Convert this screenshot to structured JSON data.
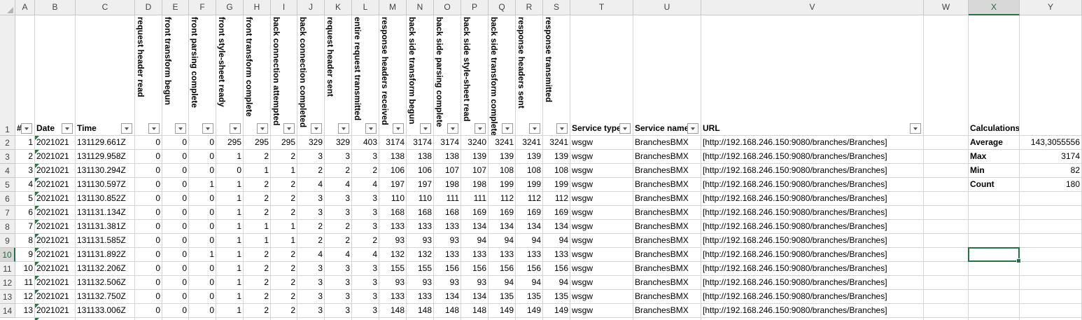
{
  "columns": [
    "A",
    "B",
    "C",
    "D",
    "E",
    "F",
    "G",
    "H",
    "I",
    "J",
    "K",
    "L",
    "M",
    "N",
    "O",
    "P",
    "Q",
    "R",
    "S",
    "T",
    "U",
    "V",
    "W",
    "X",
    "Y"
  ],
  "row_numbers": [
    "1",
    "2",
    "3",
    "4",
    "5",
    "6",
    "7",
    "8",
    "9",
    "10",
    "11",
    "12",
    "13",
    "14"
  ],
  "selected_column": "X",
  "selected_row": "10",
  "headers": {
    "A": "#",
    "B": "Date",
    "C": "Time",
    "D": "request header read",
    "E": "front transform begun",
    "F": "front parsing complete",
    "G": "front style-sheet ready",
    "H": "front transform complete",
    "I": "back connection attempted",
    "J": "back connection completed",
    "K": "request header sent",
    "L": "entire request transmitted",
    "M": "response headers received",
    "N": "back side transform begun",
    "O": "back side parsing complete",
    "P": "back side style-sheet read",
    "Q": "back side transform complete",
    "R": "response headers sent",
    "S": "response transmitted",
    "T": "Service type",
    "U": "Service name",
    "V": "URL",
    "X": "Calculations"
  },
  "rows": [
    [
      "1",
      "2021021",
      "131129.661Z",
      "0",
      "0",
      "0",
      "295",
      "295",
      "295",
      "329",
      "329",
      "403",
      "3174",
      "3174",
      "3174",
      "3240",
      "3241",
      "3241",
      "3241",
      "wsgw",
      "BranchesBMX",
      "[http://192.168.246.150:9080/branches/Branches]"
    ],
    [
      "2",
      "2021021",
      "131129.958Z",
      "0",
      "0",
      "0",
      "1",
      "2",
      "2",
      "3",
      "3",
      "3",
      "138",
      "138",
      "138",
      "139",
      "139",
      "139",
      "139",
      "wsgw",
      "BranchesBMX",
      "[http://192.168.246.150:9080/branches/Branches]"
    ],
    [
      "3",
      "2021021",
      "131130.294Z",
      "0",
      "0",
      "0",
      "0",
      "1",
      "1",
      "2",
      "2",
      "2",
      "106",
      "106",
      "107",
      "107",
      "108",
      "108",
      "108",
      "wsgw",
      "BranchesBMX",
      "[http://192.168.246.150:9080/branches/Branches]"
    ],
    [
      "4",
      "2021021",
      "131130.597Z",
      "0",
      "0",
      "1",
      "1",
      "2",
      "2",
      "4",
      "4",
      "4",
      "197",
      "197",
      "198",
      "198",
      "199",
      "199",
      "199",
      "wsgw",
      "BranchesBMX",
      "[http://192.168.246.150:9080/branches/Branches]"
    ],
    [
      "5",
      "2021021",
      "131130.852Z",
      "0",
      "0",
      "0",
      "1",
      "2",
      "2",
      "3",
      "3",
      "3",
      "110",
      "110",
      "111",
      "111",
      "112",
      "112",
      "112",
      "wsgw",
      "BranchesBMX",
      "[http://192.168.246.150:9080/branches/Branches]"
    ],
    [
      "6",
      "2021021",
      "131131.134Z",
      "0",
      "0",
      "0",
      "1",
      "2",
      "2",
      "3",
      "3",
      "3",
      "168",
      "168",
      "168",
      "169",
      "169",
      "169",
      "169",
      "wsgw",
      "BranchesBMX",
      "[http://192.168.246.150:9080/branches/Branches]"
    ],
    [
      "7",
      "2021021",
      "131131.381Z",
      "0",
      "0",
      "0",
      "1",
      "1",
      "1",
      "2",
      "2",
      "3",
      "133",
      "133",
      "133",
      "134",
      "134",
      "134",
      "134",
      "wsgw",
      "BranchesBMX",
      "[http://192.168.246.150:9080/branches/Branches]"
    ],
    [
      "8",
      "2021021",
      "131131.585Z",
      "0",
      "0",
      "0",
      "1",
      "1",
      "1",
      "2",
      "2",
      "2",
      "93",
      "93",
      "93",
      "94",
      "94",
      "94",
      "94",
      "wsgw",
      "BranchesBMX",
      "[http://192.168.246.150:9080/branches/Branches]"
    ],
    [
      "9",
      "2021021",
      "131131.892Z",
      "0",
      "0",
      "1",
      "1",
      "2",
      "2",
      "4",
      "4",
      "4",
      "132",
      "132",
      "133",
      "133",
      "133",
      "133",
      "133",
      "wsgw",
      "BranchesBMX",
      "[http://192.168.246.150:9080/branches/Branches]"
    ],
    [
      "10",
      "2021021",
      "131132.206Z",
      "0",
      "0",
      "0",
      "1",
      "2",
      "2",
      "3",
      "3",
      "3",
      "155",
      "155",
      "156",
      "156",
      "156",
      "156",
      "156",
      "wsgw",
      "BranchesBMX",
      "[http://192.168.246.150:9080/branches/Branches]"
    ],
    [
      "11",
      "2021021",
      "131132.506Z",
      "0",
      "0",
      "0",
      "1",
      "2",
      "2",
      "3",
      "3",
      "3",
      "93",
      "93",
      "93",
      "93",
      "94",
      "94",
      "94",
      "wsgw",
      "BranchesBMX",
      "[http://192.168.246.150:9080/branches/Branches]"
    ],
    [
      "12",
      "2021021",
      "131132.750Z",
      "0",
      "0",
      "0",
      "1",
      "2",
      "2",
      "3",
      "3",
      "3",
      "133",
      "133",
      "134",
      "134",
      "135",
      "135",
      "135",
      "wsgw",
      "BranchesBMX",
      "[http://192.168.246.150:9080/branches/Branches]"
    ],
    [
      "13",
      "2021021",
      "131133.006Z",
      "0",
      "0",
      "0",
      "1",
      "2",
      "2",
      "3",
      "3",
      "3",
      "148",
      "148",
      "148",
      "148",
      "149",
      "149",
      "149",
      "wsgw",
      "BranchesBMX",
      "[http://192.168.246.150:9080/branches/Branches]"
    ]
  ],
  "calculations": [
    {
      "label": "Average",
      "value": "143,3055556"
    },
    {
      "label": "Max",
      "value": "3174"
    },
    {
      "label": "Min",
      "value": "82"
    },
    {
      "label": "Count",
      "value": "180"
    }
  ],
  "colors": {
    "accent": "#217346",
    "header_bg": "#efefef",
    "gridline": "#d4d4d4",
    "error_indicator": "#1f7a35"
  }
}
